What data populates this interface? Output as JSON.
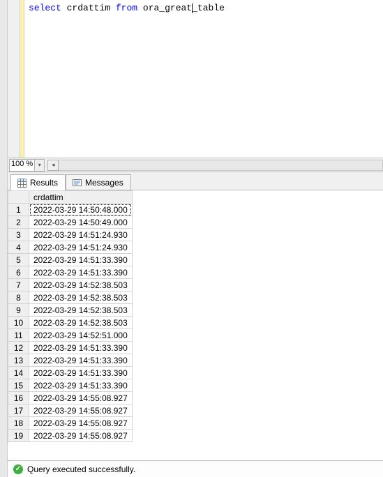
{
  "editor": {
    "sql_keyword_select": "select",
    "sql_ident_col": "crdattim",
    "sql_keyword_from": "from",
    "sql_ident_table_a": "ora_great",
    "sql_ident_table_b": "_table"
  },
  "zoom": {
    "value": "100 %"
  },
  "tabs": {
    "results": "Results",
    "messages": "Messages"
  },
  "grid": {
    "column_header": "crdattim",
    "rows": [
      "2022-03-29 14:50:48.000",
      "2022-03-29 14:50:49.000",
      "2022-03-29 14:51:24.930",
      "2022-03-29 14:51:24.930",
      "2022-03-29 14:51:33.390",
      "2022-03-29 14:51:33.390",
      "2022-03-29 14:52:38.503",
      "2022-03-29 14:52:38.503",
      "2022-03-29 14:52:38.503",
      "2022-03-29 14:52:38.503",
      "2022-03-29 14:52:51.000",
      "2022-03-29 14:51:33.390",
      "2022-03-29 14:51:33.390",
      "2022-03-29 14:51:33.390",
      "2022-03-29 14:51:33.390",
      "2022-03-29 14:55:08.927",
      "2022-03-29 14:55:08.927",
      "2022-03-29 14:55:08.927",
      "2022-03-29 14:55:08.927"
    ]
  },
  "status": {
    "message": "Query executed successfully."
  }
}
